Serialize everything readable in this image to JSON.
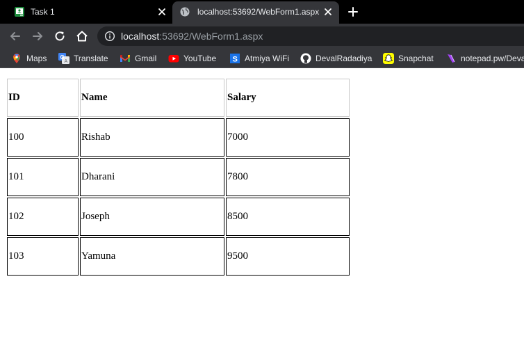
{
  "browser": {
    "tabs": [
      {
        "title": "Task 1",
        "icon": "classroom-icon",
        "active": false
      },
      {
        "title": "localhost:53692/WebForm1.aspx",
        "icon": "globe-icon",
        "active": true
      }
    ],
    "url_host": "localhost",
    "url_rest": ":53692/WebForm1.aspx",
    "bookmarks": [
      {
        "label": "Maps",
        "icon": "maps-pin-icon"
      },
      {
        "label": "Translate",
        "icon": "translate-icon"
      },
      {
        "label": "Gmail",
        "icon": "gmail-icon"
      },
      {
        "label": "YouTube",
        "icon": "youtube-icon"
      },
      {
        "label": "Atmiya WiFi",
        "icon": "s-logo-icon"
      },
      {
        "label": "DevalRadadiya",
        "icon": "github-icon"
      },
      {
        "label": "Snapchat",
        "icon": "snapchat-icon"
      },
      {
        "label": "notepad.pw/Deva",
        "icon": "notepad-icon"
      }
    ]
  },
  "table": {
    "headers": [
      "ID",
      "Name",
      "Salary"
    ],
    "rows": [
      [
        "100",
        "Rishab",
        "7000"
      ],
      [
        "101",
        "Dharani",
        "7800"
      ],
      [
        "102",
        "Joseph",
        "8500"
      ],
      [
        "103",
        "Yamuna",
        "9500"
      ]
    ]
  },
  "colors": {
    "tabstrip": "#000000",
    "toolbar": "#35363a",
    "omnibox": "#202124",
    "table_cell_border": "#000000",
    "table_header_border": "#c8c8c8"
  }
}
